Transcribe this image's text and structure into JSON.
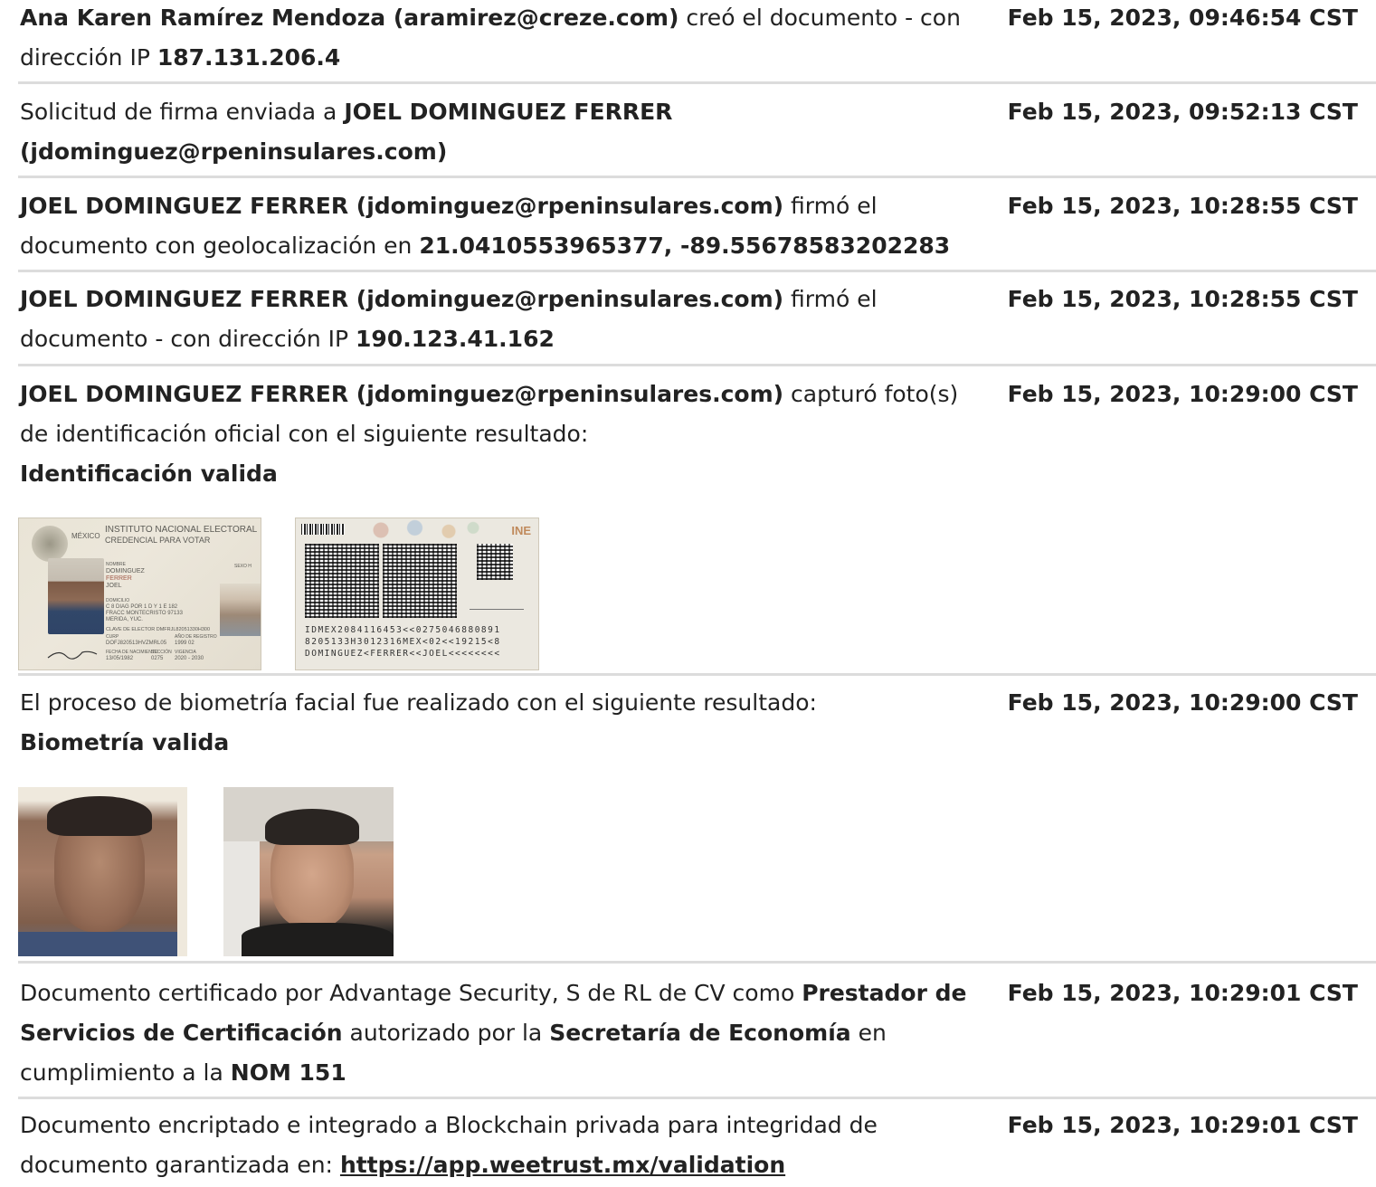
{
  "entries": [
    {
      "timestamp": "Feb 15, 2023, 09:46:54 CST",
      "parts": [
        {
          "t": "Ana Karen Ramírez Mendoza (aramirez@creze.com)",
          "b": true
        },
        {
          "t": " creó el documento - con dirección IP "
        },
        {
          "t": "187.131.206.4",
          "b": true
        }
      ]
    },
    {
      "timestamp": "Feb 15, 2023, 09:52:13 CST",
      "parts": [
        {
          "t": "Solicitud de firma enviada a "
        },
        {
          "t": "JOEL DOMINGUEZ FERRER (jdominguez@rpeninsulares.com)",
          "b": true
        }
      ]
    },
    {
      "timestamp": "Feb 15, 2023, 10:28:55 CST",
      "parts": [
        {
          "t": "JOEL DOMINGUEZ FERRER (jdominguez@rpeninsulares.com)",
          "b": true
        },
        {
          "t": " firmó el documento con geolocalización en "
        },
        {
          "t": "21.0410553965377, -89.55678583202283",
          "b": true
        }
      ]
    },
    {
      "timestamp": "Feb 15, 2023, 10:28:55 CST",
      "parts": [
        {
          "t": "JOEL DOMINGUEZ FERRER (jdominguez@rpeninsulares.com)",
          "b": true
        },
        {
          "t": " firmó el documento - con dirección IP "
        },
        {
          "t": "190.123.41.162",
          "b": true
        }
      ]
    },
    {
      "timestamp": "Feb 15, 2023, 10:29:00 CST",
      "parts": [
        {
          "t": "JOEL DOMINGUEZ FERRER (jdominguez@rpeninsulares.com)",
          "b": true
        },
        {
          "t": " capturó foto(s) de identificación oficial con el siguiente resultado:"
        },
        {
          "t": "Identificación valida",
          "b": true,
          "br": true
        }
      ]
    },
    {
      "timestamp": "Feb 15, 2023, 10:29:00 CST",
      "parts": [
        {
          "t": "El proceso de biometría facial fue realizado con el siguiente resultado:"
        },
        {
          "t": "Biometría valida",
          "b": true,
          "br": true
        }
      ]
    },
    {
      "timestamp": "Feb 15, 2023, 10:29:01 CST",
      "parts": [
        {
          "t": "Documento certificado por Advantage Security, S de RL de CV como "
        },
        {
          "t": "Prestador de Servicios de Certificación",
          "b": true
        },
        {
          "t": " autorizado por la "
        },
        {
          "t": "Secretaría de Economía",
          "b": true
        },
        {
          "t": " en cumplimiento a la "
        },
        {
          "t": "NOM 151",
          "b": true
        }
      ]
    },
    {
      "timestamp": "Feb 15, 2023, 10:29:01 CST",
      "parts": [
        {
          "t": "Documento encriptado e integrado a Blockchain privada para integridad de documento garantizada en: "
        },
        {
          "t": "https://app.weetrust.mx/validation",
          "link": true
        }
      ]
    }
  ],
  "id_front": {
    "country": "MÉXICO",
    "institute": "INSTITUTO NACIONAL ELECTORAL",
    "credential": "CREDENCIAL PARA VOTAR",
    "name_label": "NOMBRE",
    "name_lines": [
      "DOMINGUEZ",
      "FERRER",
      "JOEL"
    ],
    "sex": "SEXO H",
    "address_label": "DOMICILIO",
    "address_lines": [
      "C 8 DIAG POR 1 D Y 1 E 182",
      "FRACC MONTECRISTO 97133",
      "MERIDA, YUC."
    ],
    "clave": "CLAVE DE ELECTOR  DMFRJL82051330H300",
    "curp_label": "CURP",
    "curp": "DOFJ820513HVZMRL05",
    "registro_label": "AÑO DE REGISTRO",
    "registro": "1999  02",
    "birth_label": "FECHA DE NACIMIENTO",
    "birth": "13/05/1982",
    "section_label": "SECCIÓN",
    "section": "0275",
    "validity_label": "VIGENCIA",
    "validity": "2020 - 2030"
  },
  "id_back": {
    "brand": "INE",
    "mrz": [
      "IDMEX2084116453<<0275046880891",
      "8205133H3012316MEX<02<<19215<8",
      "DOMINGUEZ<FERRER<<JOEL<<<<<<<<"
    ]
  }
}
